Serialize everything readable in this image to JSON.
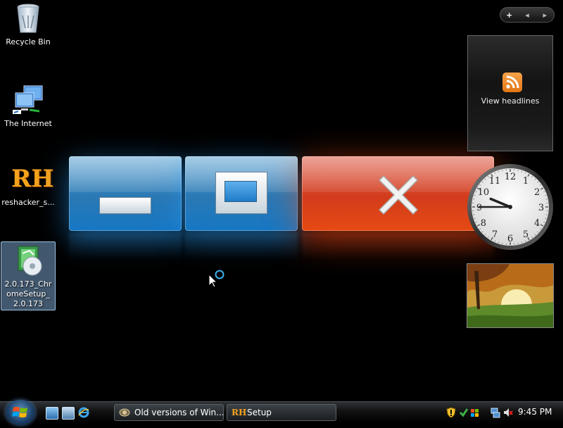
{
  "desktop": {
    "icons": [
      {
        "label": "Recycle Bin",
        "icon": "recycle-bin-icon"
      },
      {
        "label": "The Internet",
        "icon": "network-icon"
      },
      {
        "label": "reshacker_s...",
        "icon": "reshacker-icon"
      },
      {
        "label": "2.0.173_ChromeSetup_2.0.173",
        "icon": "installer-icon"
      }
    ],
    "reshacker_glyph": "RH"
  },
  "caption_buttons": {
    "minimize": "minimize-icon",
    "maximize": "maximize-icon",
    "close": "close-icon"
  },
  "sidebar": {
    "controls": {
      "add": "+",
      "prev": "◂",
      "next": "▸"
    },
    "feed_gadget": {
      "label": "View headlines"
    },
    "clock": {
      "hour": 9,
      "minute": 45,
      "numerals": [
        "12",
        "1",
        "2",
        "3",
        "4",
        "5",
        "6",
        "7",
        "8",
        "9",
        "10",
        "11"
      ]
    },
    "slideshow": {
      "subject": "autumn landscape"
    }
  },
  "taskbar": {
    "tasks": [
      {
        "label": "Old versions of Win...",
        "icon": "folder-globe-icon"
      },
      {
        "label": "Setup",
        "icon": "reshacker-icon",
        "glyph": "RH"
      }
    ],
    "clock": "9:45 PM"
  },
  "colors": {
    "caption_blue": "#2a78b4",
    "caption_red": "#d23c1c",
    "selection": "#9ec1e0",
    "rss_orange": "#e27513"
  }
}
